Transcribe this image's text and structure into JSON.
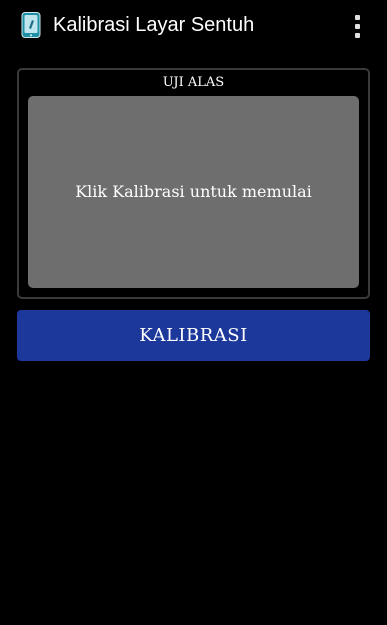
{
  "app_bar": {
    "title": "Kalibrasi Layar Sentuh",
    "icon": "phone-touch-icon",
    "menu_icon": "overflow-menu-icon"
  },
  "test_panel": {
    "title": "UJI ALAS",
    "hint": "Klik Kalibrasi untuk memulai"
  },
  "calibrate_button": {
    "label": "KALIBRASI"
  },
  "colors": {
    "background": "#000000",
    "touch_area": "#6e6e6e",
    "button": "#1c389b",
    "panel_border": "#3a3a3a"
  }
}
